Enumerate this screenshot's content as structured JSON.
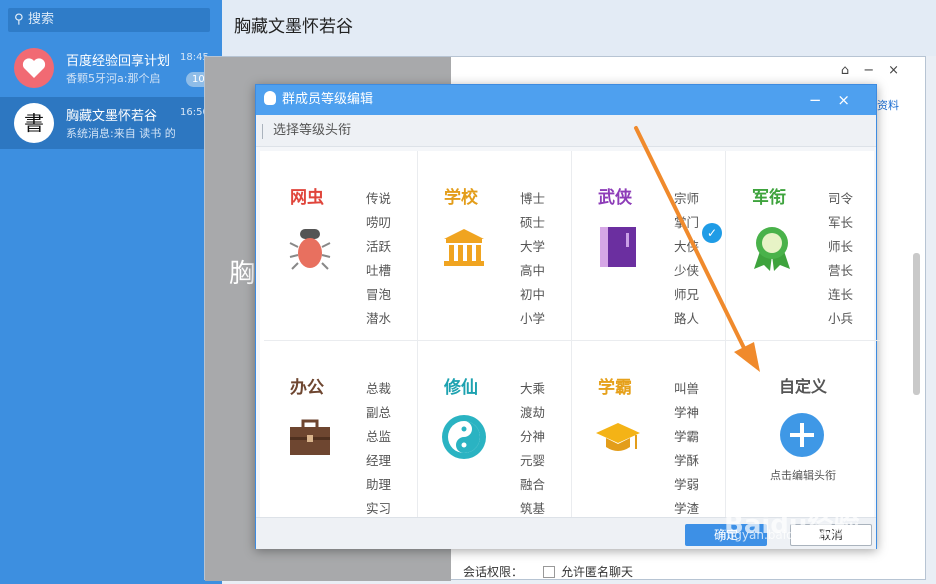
{
  "search": {
    "label": "搜索"
  },
  "chats": [
    {
      "name": "百度经验回享计划",
      "message": "香颗5牙河a:那个启",
      "time": "18:45",
      "badge": "10"
    },
    {
      "name": "胸藏文墨怀若谷",
      "message": "系统消息:来自 读书 的分享",
      "time": "16:50"
    }
  ],
  "main": {
    "title": "胸藏文墨怀若谷",
    "bg_char": "胸",
    "side_link": "资料",
    "window_controls": [
      "⌂",
      "−",
      "×"
    ]
  },
  "permissions": {
    "label": "会话权限：",
    "option": "允许匿名聊天"
  },
  "dialog": {
    "title": "群成员等级编辑",
    "controls": [
      "−",
      "×"
    ],
    "subheader": "选择等级头衔",
    "ok": "确定",
    "cancel": "取消"
  },
  "categories": [
    {
      "name": "网虫",
      "color": "#e0453b",
      "icon": "bug-icon",
      "ranks": [
        "传说",
        "唠叨",
        "活跃",
        "吐槽",
        "冒泡",
        "潜水"
      ]
    },
    {
      "name": "学校",
      "color": "#e39d1a",
      "icon": "school-building-icon",
      "ranks": [
        "博士",
        "硕士",
        "大学",
        "高中",
        "初中",
        "小学"
      ]
    },
    {
      "name": "武侠",
      "color": "#8d3cb8",
      "icon": "book-icon",
      "ranks": [
        "宗师",
        "掌门",
        "大侠",
        "少侠",
        "师兄",
        "路人"
      ],
      "selected": true
    },
    {
      "name": "军衔",
      "color": "#3ea33d",
      "icon": "medal-icon",
      "ranks": [
        "司令",
        "军长",
        "师长",
        "营长",
        "连长",
        "小兵"
      ]
    },
    {
      "name": "办公",
      "color": "#6e4630",
      "icon": "briefcase-icon",
      "ranks": [
        "总裁",
        "副总",
        "总监",
        "经理",
        "助理",
        "实习"
      ]
    },
    {
      "name": "修仙",
      "color": "#1da2b0",
      "icon": "yin-yang-icon",
      "ranks": [
        "大乘",
        "渡劫",
        "分神",
        "元婴",
        "融合",
        "筑基"
      ]
    },
    {
      "name": "学霸",
      "color": "#e6a11c",
      "icon": "graduation-cap-icon",
      "ranks": [
        "叫兽",
        "学神",
        "学霸",
        "学酥",
        "学弱",
        "学渣"
      ]
    }
  ],
  "custom": {
    "title": "自定义",
    "hint": "点击编辑头衔",
    "icon": "plus-icon"
  },
  "watermark": {
    "brand": "Baidu经验",
    "url": "jingyan.baidu.com"
  }
}
